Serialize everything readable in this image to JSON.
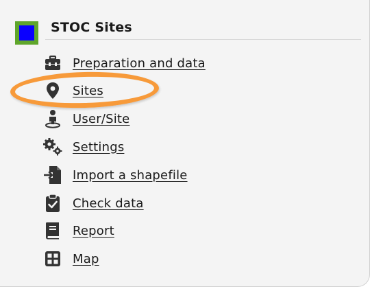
{
  "panel": {
    "title": "STOC Sites",
    "swatch_fill": "#0a00ff",
    "swatch_border": "#5fa62b"
  },
  "menu": {
    "items": [
      {
        "label": "Preparation and data",
        "icon": "toolbox-icon"
      },
      {
        "label": "Sites",
        "icon": "map-pin-icon"
      },
      {
        "label": "User/Site",
        "icon": "user-location-icon"
      },
      {
        "label": "Settings",
        "icon": "gears-icon"
      },
      {
        "label": "Import a shapefile",
        "icon": "file-import-icon"
      },
      {
        "label": "Check data",
        "icon": "clipboard-check-icon"
      },
      {
        "label": "Report",
        "icon": "book-icon"
      },
      {
        "label": "Map",
        "icon": "grid-icon"
      }
    ]
  },
  "annotation": {
    "highlight_color": "#f79a3a",
    "highlighted_item": "Sites"
  }
}
